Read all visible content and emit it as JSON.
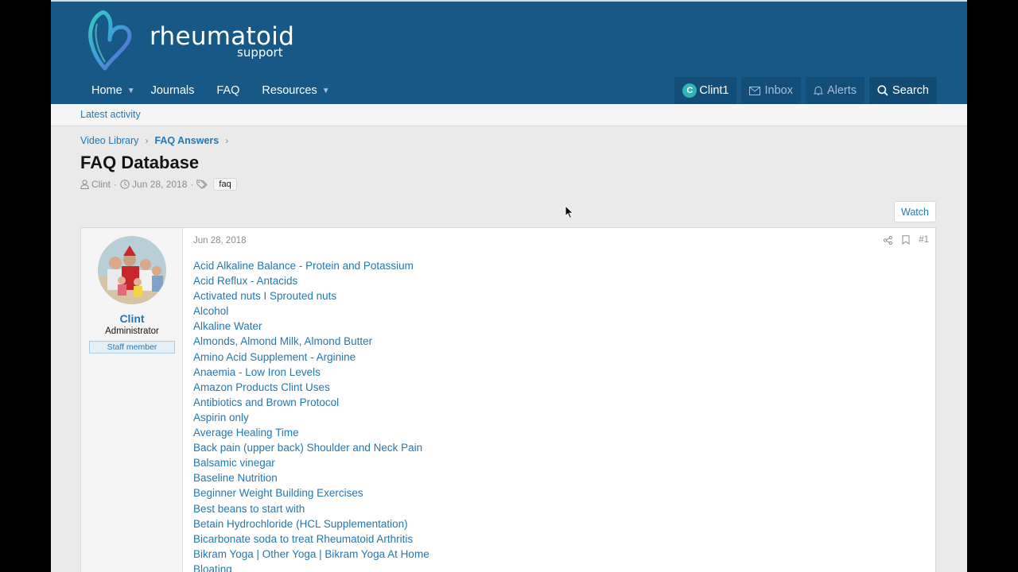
{
  "brand": {
    "title": "rheumatoid",
    "subtitle": "support",
    "colors": {
      "header": "#185886",
      "link": "#2577b1",
      "accent": "#2fb5b3"
    }
  },
  "nav": {
    "home": "Home",
    "journals": "Journals",
    "faq": "FAQ",
    "resources": "Resources"
  },
  "account": {
    "avatar_letter": "C",
    "username": "Clint1",
    "inbox": "Inbox",
    "alerts": "Alerts",
    "search": "Search"
  },
  "subnav": {
    "latest": "Latest activity"
  },
  "breadcrumb": [
    "Video Library",
    "FAQ Answers"
  ],
  "page": {
    "title": "FAQ Database",
    "author": "Clint",
    "date": "Jun 28, 2018",
    "tag": "faq",
    "watch": "Watch"
  },
  "post": {
    "date": "Jun 28, 2018",
    "number": "#1",
    "user": {
      "name": "Clint",
      "title": "Administrator",
      "badge": "Staff member"
    },
    "items": [
      "Acid Alkaline Balance - Protein and Potassium",
      "Acid Reflux - Antacids",
      "Activated nuts I Sprouted nuts",
      "Alcohol",
      "Alkaline Water",
      "Almonds, Almond Milk, Almond Butter",
      "Amino Acid Supplement - Arginine",
      "Anaemia - Low Iron Levels",
      "Amazon Products Clint Uses",
      "Antibiotics and Brown Protocol",
      "Aspirin only",
      "Average Healing Time",
      "Back pain (upper back) Shoulder and Neck Pain",
      "Balsamic vinegar",
      "Baseline Nutrition",
      "Beginner Weight Building Exercises",
      "Best beans to start with",
      "Betain Hydrochloride (HCL Supplementation)",
      "Bicarbonate soda to treat Rheumatoid Arthritis",
      "Bikram Yoga | Other Yoga | Bikram Yoga At Home",
      "Bloating"
    ]
  }
}
